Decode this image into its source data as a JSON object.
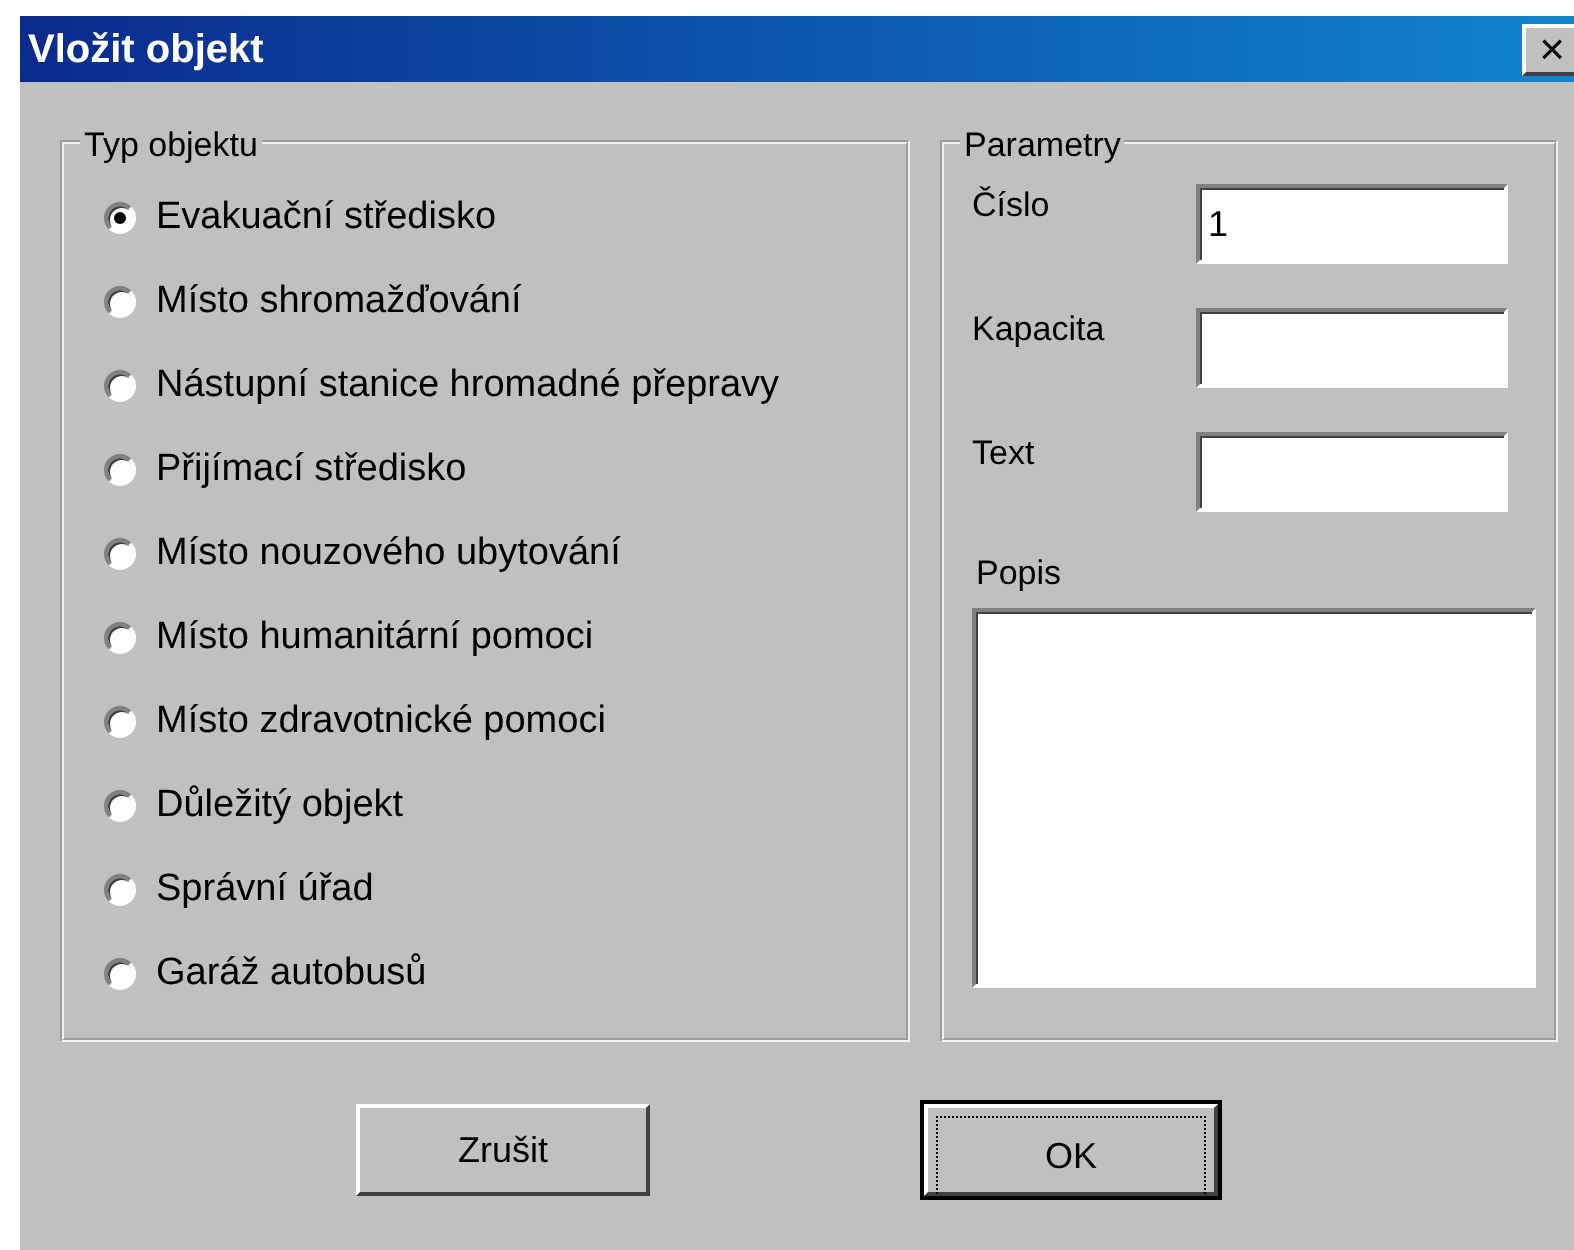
{
  "window": {
    "title": "Vložit objekt",
    "close": "×"
  },
  "object_type": {
    "title": "Typ objektu",
    "options": [
      {
        "label": "Evakuační středisko",
        "selected": true
      },
      {
        "label": "Místo shromažďování",
        "selected": false
      },
      {
        "label": "Nástupní stanice hromadné přepravy",
        "selected": false
      },
      {
        "label": "Přijímací středisko",
        "selected": false
      },
      {
        "label": "Místo nouzového ubytování",
        "selected": false
      },
      {
        "label": "Místo humanitární pomoci",
        "selected": false
      },
      {
        "label": "Místo zdravotnické pomoci",
        "selected": false
      },
      {
        "label": "Důležitý objekt",
        "selected": false
      },
      {
        "label": "Správní úřad",
        "selected": false
      },
      {
        "label": "Garáž autobusů",
        "selected": false
      }
    ]
  },
  "parameters": {
    "title": "Parametry",
    "fields": [
      {
        "label": "Číslo",
        "value": "1"
      },
      {
        "label": "Kapacita"
      },
      {
        "label": "Text"
      }
    ],
    "description": {
      "label": "Popis"
    }
  },
  "buttons": [
    {
      "label": "Zrušit",
      "default": false
    },
    {
      "label": "OK",
      "default": true
    }
  ]
}
